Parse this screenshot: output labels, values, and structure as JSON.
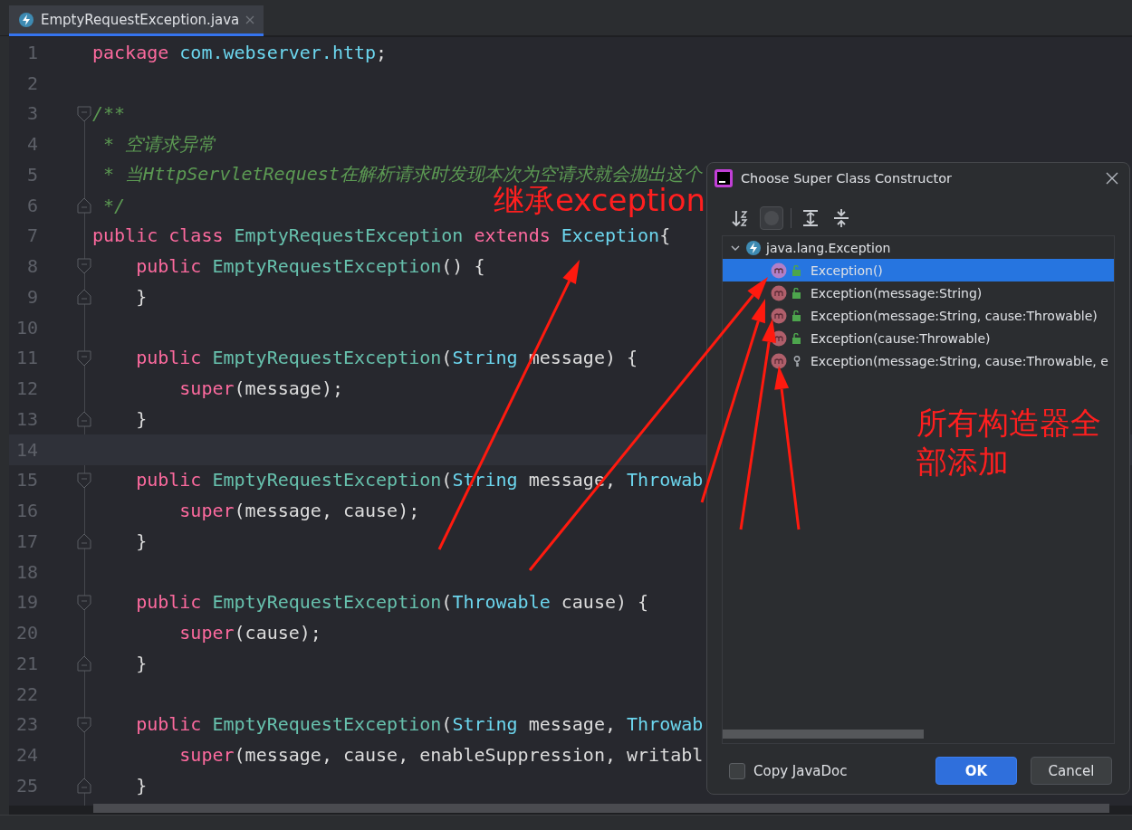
{
  "tabs": [
    {
      "label": "EmptyRequestException.java",
      "selected": true
    }
  ],
  "editor": {
    "lines": [
      {
        "number": "1",
        "tokens": [
          {
            "kind": "kw",
            "text": "package "
          },
          {
            "kind": "type",
            "text": "com.webserver.http"
          },
          {
            "kind": "plain",
            "text": ";"
          }
        ]
      },
      {
        "number": "2"
      },
      {
        "number": "3",
        "fold_start": true,
        "tokens": [
          {
            "kind": "comment",
            "text": "/**"
          }
        ]
      },
      {
        "number": "4",
        "tokens": [
          {
            "kind": "comment",
            "text": " * 空请求异常"
          }
        ]
      },
      {
        "number": "5",
        "tokens": [
          {
            "kind": "comment",
            "text": " * 当HttpServletRequest在解析请求时发现本次为空请求就会抛出这个"
          }
        ]
      },
      {
        "number": "6",
        "fold_end": true,
        "tokens": [
          {
            "kind": "comment",
            "text": " */"
          }
        ]
      },
      {
        "number": "7",
        "tokens": [
          {
            "kind": "kw",
            "text": "public class "
          },
          {
            "kind": "decl",
            "text": "EmptyRequestException "
          },
          {
            "kind": "kw",
            "text": "extends "
          },
          {
            "kind": "type",
            "text": "Exception"
          },
          {
            "kind": "plain",
            "text": "{"
          }
        ]
      },
      {
        "number": "8",
        "fold_start": true,
        "tokens": [
          {
            "kind": "kw",
            "text": "    public "
          },
          {
            "kind": "decl",
            "text": "EmptyRequestException"
          },
          {
            "kind": "plain",
            "text": "() {"
          }
        ]
      },
      {
        "number": "9",
        "fold_end": true,
        "tokens": [
          {
            "kind": "plain",
            "text": "    }"
          }
        ]
      },
      {
        "number": "10"
      },
      {
        "number": "11",
        "fold_start": true,
        "tokens": [
          {
            "kind": "kw",
            "text": "    public "
          },
          {
            "kind": "decl",
            "text": "EmptyRequestException"
          },
          {
            "kind": "plain",
            "text": "("
          },
          {
            "kind": "type",
            "text": "String"
          },
          {
            "kind": "plain",
            "text": " message) {"
          }
        ]
      },
      {
        "number": "12",
        "tokens": [
          {
            "kind": "kw",
            "text": "        super"
          },
          {
            "kind": "plain",
            "text": "(message);"
          }
        ]
      },
      {
        "number": "13",
        "fold_end": true,
        "tokens": [
          {
            "kind": "plain",
            "text": "    }"
          }
        ]
      },
      {
        "number": "14",
        "current": true
      },
      {
        "number": "15",
        "fold_start": true,
        "tokens": [
          {
            "kind": "kw",
            "text": "    public "
          },
          {
            "kind": "decl",
            "text": "EmptyRequestException"
          },
          {
            "kind": "plain",
            "text": "("
          },
          {
            "kind": "type",
            "text": "String"
          },
          {
            "kind": "plain",
            "text": " message, "
          },
          {
            "kind": "type",
            "text": "Throwab"
          }
        ]
      },
      {
        "number": "16",
        "tokens": [
          {
            "kind": "kw",
            "text": "        super"
          },
          {
            "kind": "plain",
            "text": "(message, cause);"
          }
        ]
      },
      {
        "number": "17",
        "fold_end": true,
        "tokens": [
          {
            "kind": "plain",
            "text": "    }"
          }
        ]
      },
      {
        "number": "18"
      },
      {
        "number": "19",
        "fold_start": true,
        "tokens": [
          {
            "kind": "kw",
            "text": "    public "
          },
          {
            "kind": "decl",
            "text": "EmptyRequestException"
          },
          {
            "kind": "plain",
            "text": "("
          },
          {
            "kind": "type",
            "text": "Throwable"
          },
          {
            "kind": "plain",
            "text": " cause) {"
          }
        ]
      },
      {
        "number": "20",
        "tokens": [
          {
            "kind": "kw",
            "text": "        super"
          },
          {
            "kind": "plain",
            "text": "(cause);"
          }
        ]
      },
      {
        "number": "21",
        "fold_end": true,
        "tokens": [
          {
            "kind": "plain",
            "text": "    }"
          }
        ]
      },
      {
        "number": "22"
      },
      {
        "number": "23",
        "fold_start": true,
        "tokens": [
          {
            "kind": "kw",
            "text": "    public "
          },
          {
            "kind": "decl",
            "text": "EmptyRequestException"
          },
          {
            "kind": "plain",
            "text": "("
          },
          {
            "kind": "type",
            "text": "String"
          },
          {
            "kind": "plain",
            "text": " message, "
          },
          {
            "kind": "type",
            "text": "Throwab"
          }
        ]
      },
      {
        "number": "24",
        "tokens": [
          {
            "kind": "kw",
            "text": "        super"
          },
          {
            "kind": "plain",
            "text": "(message, cause, enableSuppression, writabl"
          }
        ]
      },
      {
        "number": "25",
        "fold_end": true,
        "tokens": [
          {
            "kind": "plain",
            "text": "    }"
          }
        ]
      }
    ]
  },
  "dialog": {
    "title": "Choose Super Class Constructor",
    "toolbar": [
      {
        "kind": "sort",
        "on": false
      },
      {
        "kind": "classes",
        "on": true
      },
      {
        "kind": "expand",
        "on": false
      },
      {
        "kind": "collapse",
        "on": false
      }
    ],
    "tree": {
      "label": "java.lang.Exception",
      "expanded": true,
      "children": [
        {
          "label": "Exception()",
          "kind": "public",
          "selected": true
        },
        {
          "label": "Exception(message:String)",
          "kind": "public",
          "selected": false
        },
        {
          "label": "Exception(message:String, cause:Throwable)",
          "kind": "public",
          "selected": false
        },
        {
          "label": "Exception(cause:Throwable)",
          "kind": "public",
          "selected": false
        },
        {
          "label": "Exception(message:String, cause:Throwable, e",
          "kind": "protected",
          "selected": false
        }
      ]
    },
    "copy_javadoc": {
      "label": "Copy JavaDoc",
      "checked": false
    },
    "buttons": [
      {
        "label": "OK",
        "default": true
      },
      {
        "label": "Cancel",
        "default": false
      }
    ]
  },
  "annotations": [
    {
      "text": "继承exception"
    },
    {
      "text": "所有构造器全部添加"
    }
  ]
}
